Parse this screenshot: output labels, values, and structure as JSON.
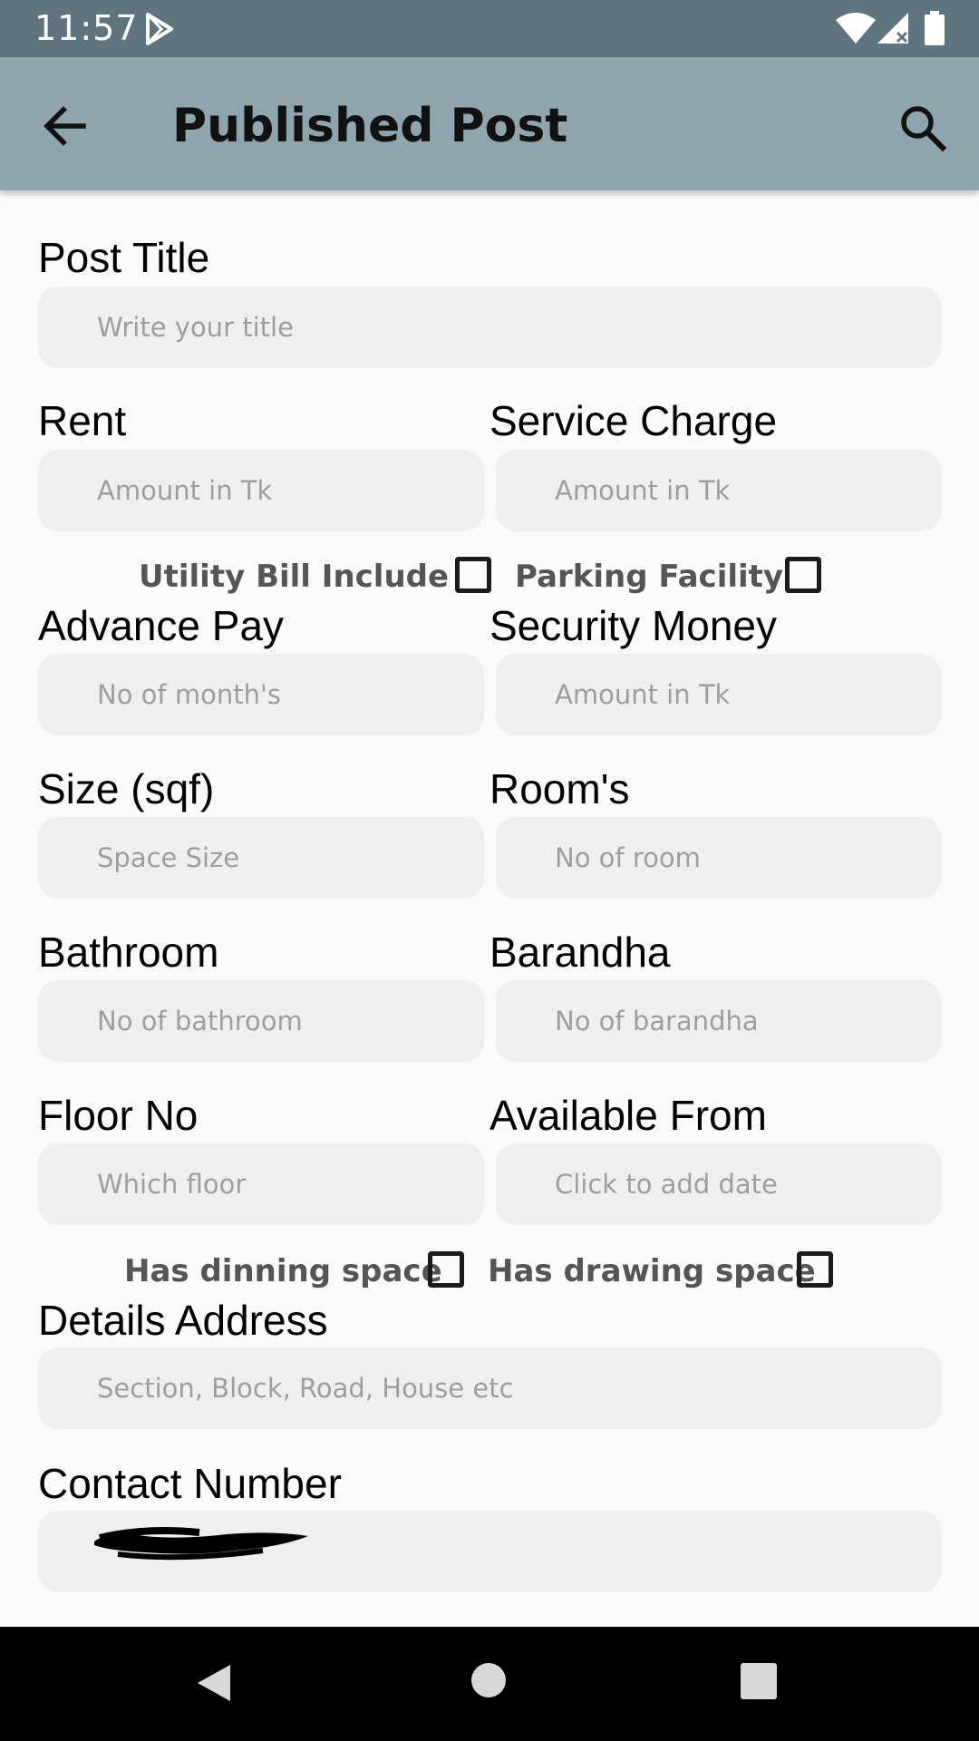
{
  "status_bar": {
    "time": "11:57"
  },
  "app_bar": {
    "title": "Published Post"
  },
  "form": {
    "post_title": {
      "label": "Post Title",
      "placeholder": "Write your title"
    },
    "rent": {
      "label": "Rent",
      "placeholder": "Amount in Tk"
    },
    "service_charge": {
      "label": "Service Charge",
      "placeholder": "Amount in Tk"
    },
    "utility_bill": {
      "label": "Utility Bill Include",
      "checked": false
    },
    "parking": {
      "label": "Parking Facility",
      "checked": false
    },
    "advance_pay": {
      "label": "Advance Pay",
      "placeholder": "No of month's"
    },
    "security_money": {
      "label": "Security Money",
      "placeholder": "Amount in Tk"
    },
    "size": {
      "label": "Size (sqf)",
      "placeholder": "Space Size"
    },
    "rooms": {
      "label": "Room's",
      "placeholder": "No of room"
    },
    "bathroom": {
      "label": "Bathroom",
      "placeholder": "No of bathroom"
    },
    "barandha": {
      "label": "Barandha",
      "placeholder": "No of barandha"
    },
    "floor_no": {
      "label": "Floor No",
      "placeholder": "Which floor"
    },
    "available_from": {
      "label": "Available From",
      "placeholder": "Click to add date"
    },
    "dinning_space": {
      "label": "Has dinning space",
      "checked": false
    },
    "drawing_space": {
      "label": "Has drawing space",
      "checked": false
    },
    "details_address": {
      "label": "Details Address",
      "placeholder": "Section, Block, Road, House etc"
    },
    "contact_number": {
      "label": "Contact Number",
      "value": ""
    }
  }
}
